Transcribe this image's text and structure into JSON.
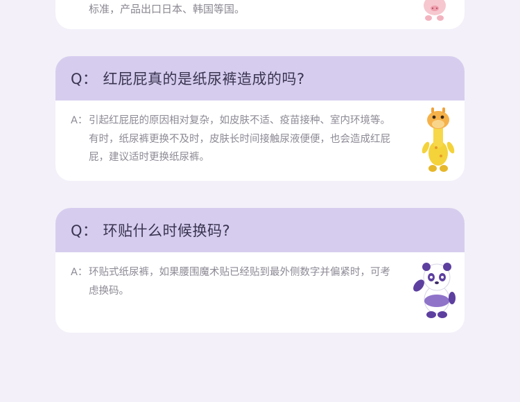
{
  "top_card": {
    "answer_tail": "标准，产品出口日本、韩国等国。"
  },
  "faqs": [
    {
      "q_label": "Q：",
      "question": "红屁屁真的是纸尿裤造成的吗?",
      "a_label": "A：",
      "answer": "引起红屁屁的原因相对复杂，如皮肤不适、疫苗接种、室内环境等。有时，纸尿裤更换不及时，皮肤长时间接触尿液便便，也会造成红屁屁，建议适时更换纸尿裤。",
      "mascot": "giraffe-mascot"
    },
    {
      "q_label": "Q：",
      "question": "环贴什么时候换码?",
      "a_label": "A：",
      "answer": "环贴式纸尿裤，如果腰围魔术贴已经贴到最外侧数字并偏紧时，可考虑换码。",
      "mascot": "panda-mascot"
    }
  ],
  "colors": {
    "background": "#f3f0f9",
    "question_bar": "#d6cdee",
    "question_text": "#3a3450",
    "answer_text": "#8d8a94"
  }
}
